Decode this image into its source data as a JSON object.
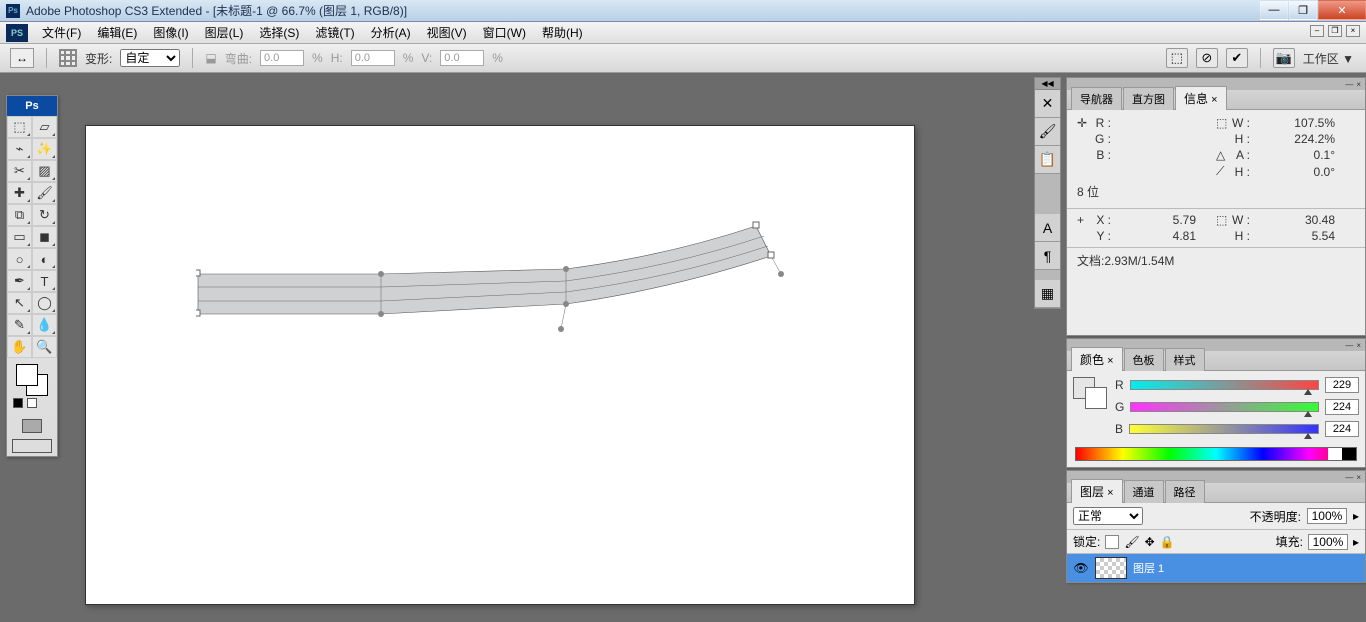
{
  "titlebar": {
    "app": "Adobe Photoshop CS3 Extended",
    "doc": "[未标题-1 @ 66.7% (图层 1, RGB/8)]"
  },
  "menus": [
    "文件(F)",
    "编辑(E)",
    "图像(I)",
    "图层(L)",
    "选择(S)",
    "滤镜(T)",
    "分析(A)",
    "视图(V)",
    "窗口(W)",
    "帮助(H)"
  ],
  "optbar": {
    "warp_label": "变形:",
    "warp_mode": "自定",
    "bend_label": "弯曲:",
    "bend": "0.0",
    "h_label": "H:",
    "h": "0.0",
    "v_label": "V:",
    "v": "0.0",
    "pct": "%",
    "workspace": "工作区 ▼"
  },
  "info": {
    "tabs": [
      "导航器",
      "直方图",
      "信息"
    ],
    "R": "R :",
    "G": "G :",
    "B": "B :",
    "W": "W :",
    "H": "H :",
    "A": "A :",
    "H2": "H :",
    "W_val": "107.5%",
    "H_val": "224.2%",
    "A_val": "0.1°",
    "H2_val": "0.0°",
    "bit": "8 位",
    "X": "X :",
    "Y": "Y :",
    "X_val": "5.79",
    "Y_val": "4.81",
    "W2": "W :",
    "H3": "H :",
    "W2_val": "30.48",
    "H3_val": "5.54",
    "doc": "文档:2.93M/1.54M"
  },
  "color": {
    "tabs": [
      "颜色",
      "色板",
      "样式"
    ],
    "R": "R",
    "G": "G",
    "B": "B",
    "R_val": "229",
    "G_val": "224",
    "B_val": "224"
  },
  "layers": {
    "tabs": [
      "图层",
      "通道",
      "路径"
    ],
    "mode": "正常",
    "opacity_label": "不透明度:",
    "opacity": "100%",
    "lock_label": "锁定:",
    "fill_label": "填充:",
    "fill": "100%",
    "layer1": "图层 1"
  }
}
